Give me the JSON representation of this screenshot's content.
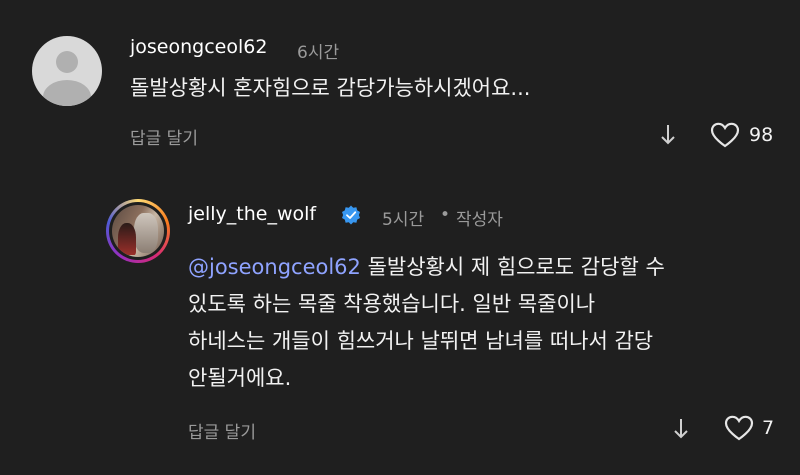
{
  "comment1": {
    "username": "joseongceol62",
    "time": "6시간",
    "text": "돌발상황시 혼자힘으로 감당가능하시겠어요...",
    "reply_label": "답글 달기",
    "likes": "98"
  },
  "comment2": {
    "username": "jelly_the_wolf",
    "time": "5시간",
    "separator": "•",
    "author_badge": "작성자",
    "mention": "@joseongceol62",
    "text_line1": " 돌발상황시 제 힘으로도 감당할 수",
    "text_line2": "있도록 하는 목줄 착용했습니다. 일반 목줄이나",
    "text_line3": "하네스는 개들이 힘쓰거나 날뛰면 남녀를 떠나서 감당",
    "text_line4": "안될거에요.",
    "reply_label": "답글 달기",
    "likes": "7"
  },
  "colors": {
    "background": "#1f1f1f",
    "mention": "#8fa3ff",
    "verified": "#3897f0",
    "muted": "#9a9a9a"
  }
}
